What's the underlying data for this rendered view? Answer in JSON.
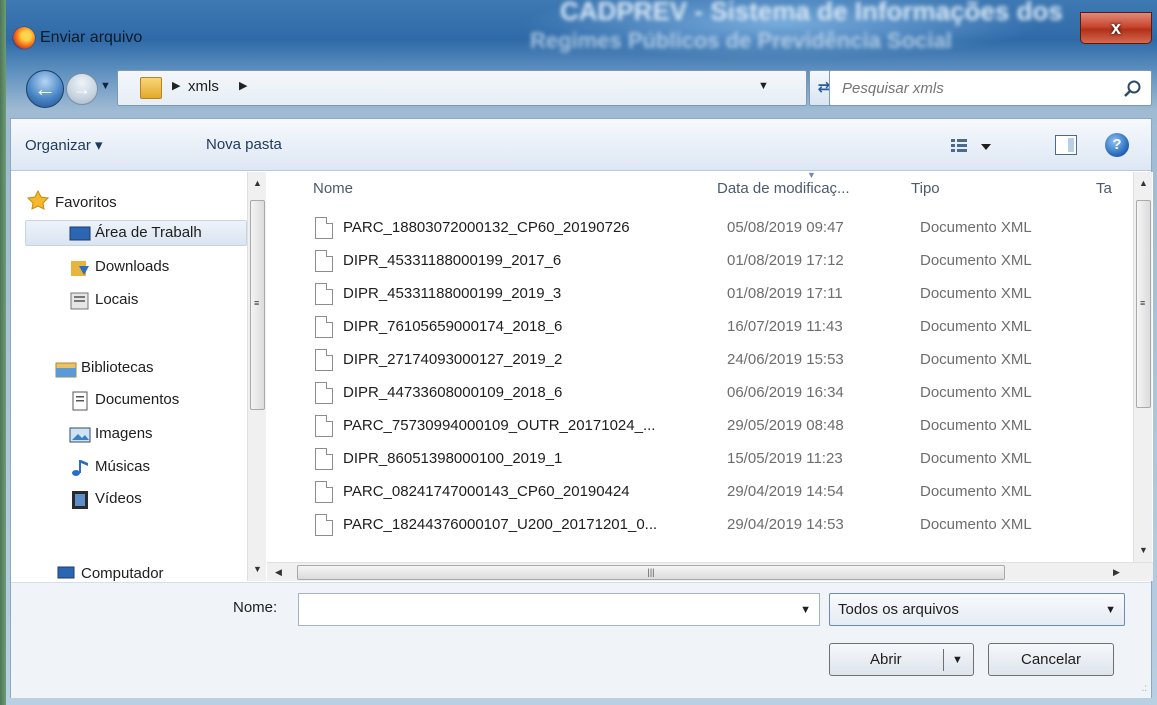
{
  "window": {
    "title": "Enviar arquivo",
    "background_title_1": "CADPREV - Sistema de Informações dos",
    "background_title_2": "Regimes Públicos de Previdência Social",
    "close_label": "x"
  },
  "address": {
    "crumb": "xmls",
    "search_placeholder": "Pesquisar xmls"
  },
  "toolbar": {
    "organize_label": "Organizar ▾",
    "new_folder_label": "Nova pasta"
  },
  "nav": {
    "favorites": "Favoritos",
    "desktop": "Área de Trabalh",
    "downloads": "Downloads",
    "places": "Locais",
    "libraries": "Bibliotecas",
    "documents": "Documentos",
    "images": "Imagens",
    "music": "Músicas",
    "videos": "Vídeos",
    "computer": "Computador"
  },
  "columns": {
    "name": "Nome",
    "date": "Data de modificaç...",
    "type": "Tipo",
    "size": "Ta"
  },
  "files": [
    {
      "name": "PARC_18803072000132_CP60_20190726",
      "date": "05/08/2019 09:47",
      "type": "Documento XML"
    },
    {
      "name": "DIPR_45331188000199_2017_6",
      "date": "01/08/2019 17:12",
      "type": "Documento XML"
    },
    {
      "name": "DIPR_45331188000199_2019_3",
      "date": "01/08/2019 17:11",
      "type": "Documento XML"
    },
    {
      "name": "DIPR_76105659000174_2018_6",
      "date": "16/07/2019 11:43",
      "type": "Documento XML"
    },
    {
      "name": "DIPR_27174093000127_2019_2",
      "date": "24/06/2019 15:53",
      "type": "Documento XML"
    },
    {
      "name": "DIPR_44733608000109_2018_6",
      "date": "06/06/2019 16:34",
      "type": "Documento XML"
    },
    {
      "name": "PARC_75730994000109_OUTR_20171024_...",
      "date": "29/05/2019 08:48",
      "type": "Documento XML"
    },
    {
      "name": "DIPR_86051398000100_2019_1",
      "date": "15/05/2019 11:23",
      "type": "Documento XML"
    },
    {
      "name": "PARC_08241747000143_CP60_20190424",
      "date": "29/04/2019 14:54",
      "type": "Documento XML"
    },
    {
      "name": "PARC_18244376000107_U200_20171201_0...",
      "date": "29/04/2019 14:53",
      "type": "Documento XML"
    }
  ],
  "bottom": {
    "name_label": "Nome:",
    "name_value": "",
    "filter_value": "Todos os arquivos",
    "open_label": "Abrir",
    "cancel_label": "Cancelar"
  },
  "colors": {
    "accent": "#2f6aa8",
    "close": "#c9472f"
  }
}
